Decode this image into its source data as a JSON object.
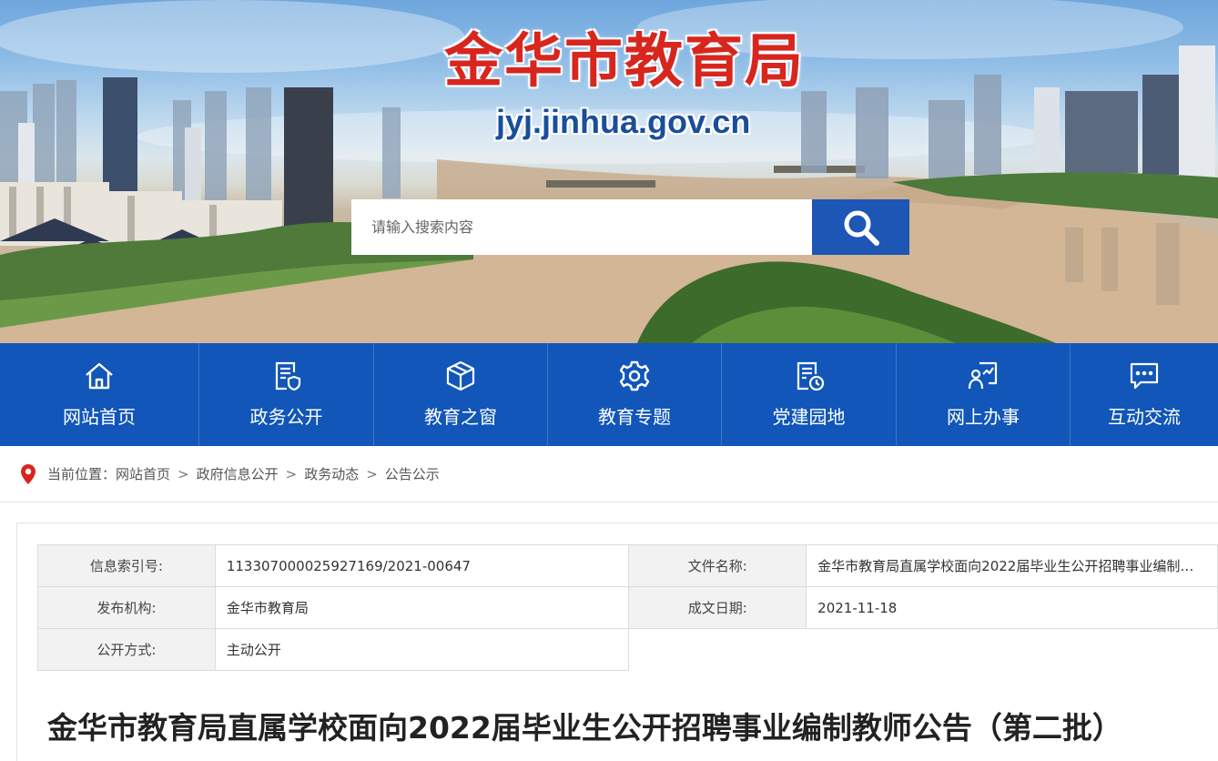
{
  "header": {
    "site_title": "金华市教育局",
    "site_url": "jyj.jinhua.gov.cn",
    "search_placeholder": "请输入搜索内容",
    "search_icon": "search-icon"
  },
  "nav": {
    "items": [
      {
        "label": "网站首页",
        "icon": "home-icon"
      },
      {
        "label": "政务公开",
        "icon": "document-shield-icon"
      },
      {
        "label": "教育之窗",
        "icon": "cube-icon"
      },
      {
        "label": "教育专题",
        "icon": "gear-icon"
      },
      {
        "label": "党建园地",
        "icon": "document-clock-icon"
      },
      {
        "label": "网上办事",
        "icon": "chart-user-icon"
      },
      {
        "label": "互动交流",
        "icon": "chat-icon"
      }
    ]
  },
  "breadcrumb": {
    "prefix": "当前位置：",
    "items": [
      "网站首页",
      "政府信息公开",
      "政务动态",
      "公告公示"
    ],
    "separator": ">"
  },
  "meta": {
    "index_label": "信息索引号:",
    "index_value": "113307000025927169/2021-00647",
    "file_name_label": "文件名称:",
    "file_name_value": "金华市教育局直属学校面向2022届毕业生公开招聘事业编制…",
    "publisher_label": "发布机构:",
    "publisher_value": "金华市教育局",
    "date_label": "成文日期:",
    "date_value": "2021-11-18",
    "disclosure_label": "公开方式:",
    "disclosure_value": "主动公开"
  },
  "article": {
    "title": "金华市教育局直属学校面向2022届毕业生公开招聘事业编制教师公告（第二批）"
  },
  "colors": {
    "nav_bg": "#1156b8",
    "search_btn": "#1d56b5",
    "title_red": "#d7261e",
    "pin_red": "#d9251c"
  }
}
